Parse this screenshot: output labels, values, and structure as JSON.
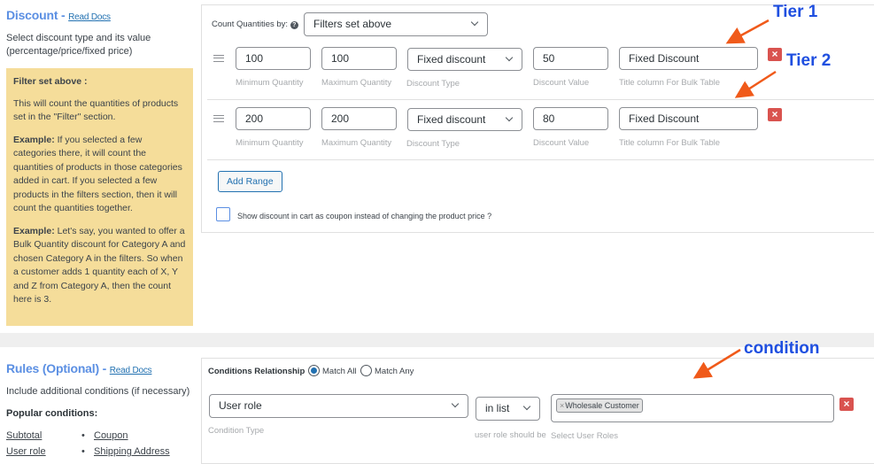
{
  "discount": {
    "title": "Discount -",
    "read_docs": "Read Docs",
    "description": "Select discount type and its value (percentage/price/fixed price)",
    "note": {
      "heading": "Filter set above :",
      "para1": "This will count the quantities of products set in the \"Filter\" section.",
      "example_label": "Example:",
      "para2": " If you selected a few categories there, it will count the quantities of products in those categories added in cart. If you selected a few products in the filters section, then it will count the quantities together.",
      "para3": " Let's say, you wanted to offer a Bulk Quantity discount for Category A and chosen Category A in the filters. So when a customer adds 1 quantity each of X, Y and Z from Category A, then the count here is 3."
    },
    "count_label": "Count Quantities by:",
    "count_value": "Filters set above",
    "ranges": [
      {
        "min": "100",
        "max": "100",
        "type": "Fixed discount",
        "value": "50",
        "title": "Fixed Discount"
      },
      {
        "min": "200",
        "max": "200",
        "type": "Fixed discount",
        "value": "80",
        "title": "Fixed Discount"
      }
    ],
    "labels": {
      "min": "Minimum Quantity",
      "max": "Maximum Quantity",
      "type": "Discount Type",
      "value": "Discount Value",
      "title": "Title column For Bulk Table"
    },
    "add_range": "Add Range",
    "coupon_checkbox": "Show discount in cart as coupon instead of changing the product price ?",
    "coupon_checked": false
  },
  "rules": {
    "title": "Rules (Optional) -",
    "read_docs": "Read Docs",
    "description": "Include additional conditions (if necessary)",
    "popular_heading": "Popular conditions:",
    "popular_col1": [
      "Subtotal",
      "User role"
    ],
    "popular_col2": [
      "Coupon",
      "Shipping Address"
    ],
    "relationship_label": "Conditions Relationship",
    "match_all": "Match All",
    "match_any": "Match Any",
    "selected_relationship": "Match All",
    "condition": {
      "type": "User role",
      "type_label": "Condition Type",
      "operator": "in list",
      "operator_label": "user role should be",
      "tag": "Wholesale Customer",
      "values_label": "Select User Roles"
    }
  },
  "annotations": {
    "tier1": "Tier 1",
    "tier2": "Tier 2",
    "condition": "condition",
    "arrow_color": "#f05a1a",
    "text_color": "#1f4fe0"
  }
}
